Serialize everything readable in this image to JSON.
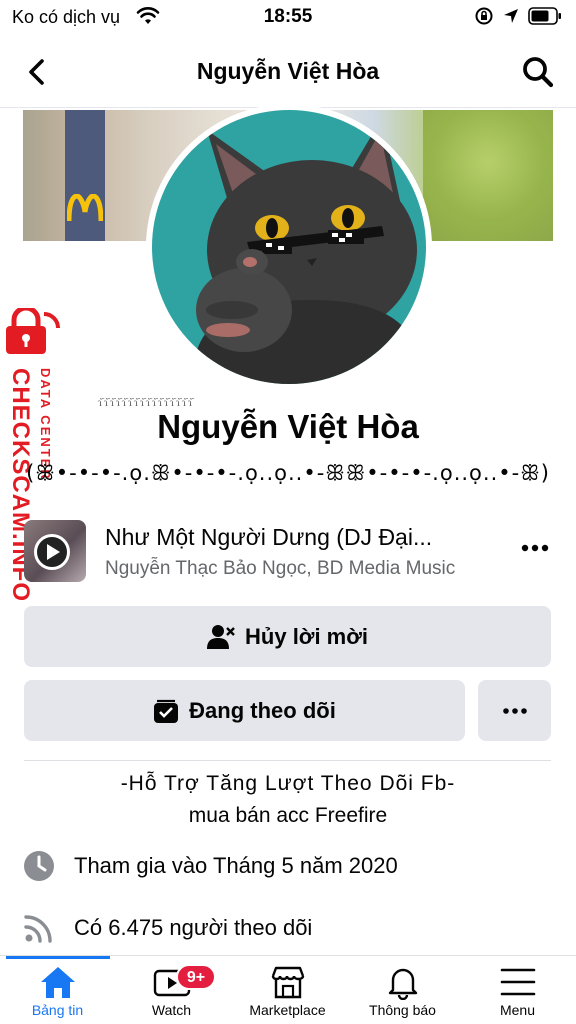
{
  "status_bar": {
    "carrier": "Ko có dịch vụ",
    "time": "18:55"
  },
  "nav": {
    "title": "Nguyễn Việt Hòa"
  },
  "profile": {
    "name": "Nguyễn Việt Hòa",
    "nickname": "(ꕥ•-•-•-.ọ.ꕥ•-•-•-.ọ..ọ..•-ꕥꕥ•-•-•-.ọ..ọ..•-ꕥ)",
    "name_decoration": "ɿ᷃ɿ᷃ɿ᷃ɿ᷃ɿ᷃ɿ᷃ɿ᷃ɿ᷃ɿ᷃ɿ᷃ɿ᷃ɿ᷃ɿ᷃ɿ᷃ɿ᷃ɿ᷃"
  },
  "watermark": {
    "brand": "CHECKSCAM.INFO",
    "sub": "DATA CENTER"
  },
  "music": {
    "title": "Như Một Người Dưng (DJ Đại...",
    "artist": "Nguyễn Thạc Bảo Ngọc, BD Media Music"
  },
  "actions": {
    "cancel_request": "Hủy lời mời",
    "following": "Đang theo dõi"
  },
  "bio": {
    "line1": "-Hỗ Trợ Tăng Lượt Theo Dõi Fb-",
    "line2": "mua bán acc Freefire"
  },
  "details": {
    "joined": "Tham gia vào Tháng 5 năm 2020",
    "followers": "Có 6.475 người theo dõi"
  },
  "tabs": [
    {
      "label": "Bảng tin",
      "icon": "home-icon",
      "active": true
    },
    {
      "label": "Watch",
      "icon": "watch-icon",
      "badge": "9+"
    },
    {
      "label": "Marketplace",
      "icon": "marketplace-icon"
    },
    {
      "label": "Thông báo",
      "icon": "bell-icon"
    },
    {
      "label": "Menu",
      "icon": "menu-icon"
    }
  ],
  "colors": {
    "accent": "#1877f2",
    "button_bg": "#e4e6eb",
    "badge": "#e41e3f",
    "watermark": "#e31b23",
    "secondary_text": "#65676b"
  }
}
